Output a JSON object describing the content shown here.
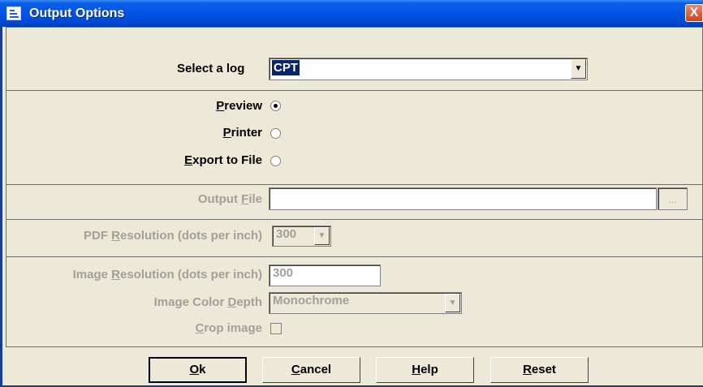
{
  "window": {
    "title": "Output Options",
    "close_glyph": "X"
  },
  "log": {
    "label": "Select a log",
    "value": "CPT"
  },
  "output_dest": {
    "options": [
      {
        "key": "P",
        "rest": "review",
        "selected": true
      },
      {
        "key": "P",
        "rest": "rinter",
        "selected": false
      },
      {
        "key": "E",
        "rest": "xport to File",
        "selected": false
      }
    ]
  },
  "output_file": {
    "label_pre": "Output ",
    "label_key": "F",
    "label_post": "ile",
    "value": "",
    "browse": "..."
  },
  "pdf_res": {
    "label_pre": "PDF ",
    "label_key": "R",
    "label_post": "esolution (dots per inch)",
    "value": "300"
  },
  "image": {
    "res_pre": "Image ",
    "res_key": "R",
    "res_post": "esolution (dots per inch)",
    "res_value": "300",
    "depth_pre": "Image Color ",
    "depth_key": "D",
    "depth_post": "epth",
    "depth_value": "Monochrome",
    "crop_key": "C",
    "crop_post": "rop image",
    "crop_checked": false
  },
  "buttons": {
    "ok_key": "O",
    "ok_rest": "k",
    "cancel_key": "C",
    "cancel_rest": "ancel",
    "help_key": "H",
    "help_rest": "elp",
    "reset_key": "R",
    "reset_rest": "eset"
  },
  "icons": {
    "window_icon": "app-window-icon",
    "dropdown": "chevron-down-icon",
    "close": "close-icon"
  }
}
